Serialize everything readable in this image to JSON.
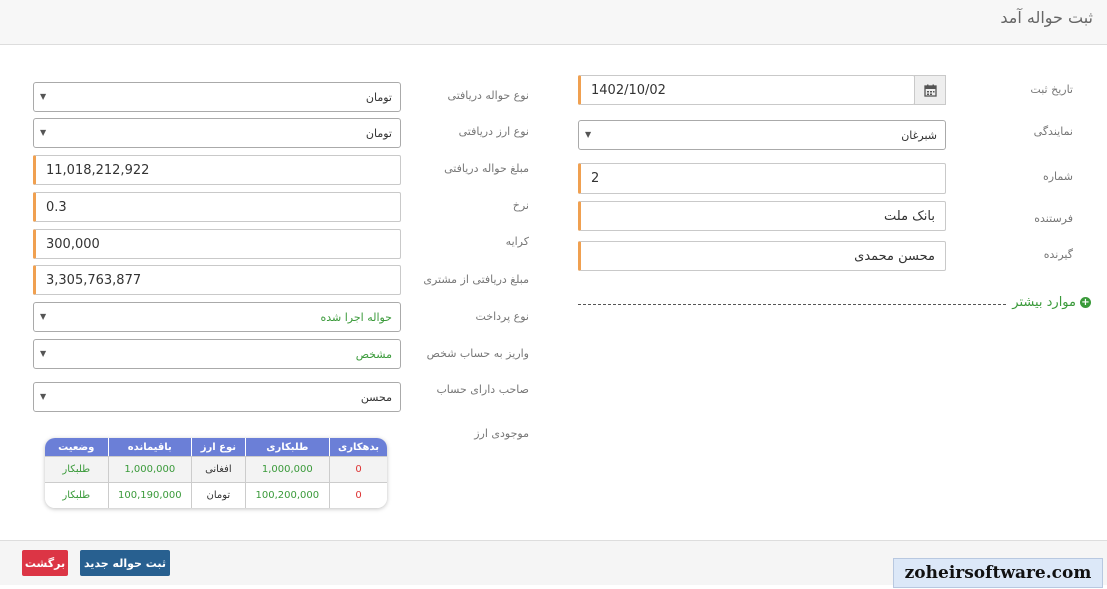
{
  "page": {
    "title": "ثبت حواله آمد"
  },
  "right_form": {
    "date_label": "تاریخ ثبت",
    "date_value": "1402/10/02",
    "agency_label": "نمایندگی",
    "agency_value": "شبرغان",
    "number_label": "شماره",
    "number_value": "2",
    "sender_label": "فرستنده",
    "sender_value": "بانک ملت",
    "receiver_label": "گیرنده",
    "receiver_value": "محسن محمدی",
    "more_label": "موارد بیشتر"
  },
  "left_form": {
    "transfer_type_label": "نوع حواله دریافتی",
    "transfer_type_value": "تومان",
    "currency_type_label": "نوع ارز دریافتی",
    "currency_type_value": "تومان",
    "amount_label": "مبلغ حواله دریافتی",
    "amount_value": "11,018,212,922",
    "rate_label": "نرخ",
    "rate_value": "0.3",
    "fee_label": "کرایه",
    "fee_value": "300,000",
    "customer_amount_label": "مبلغ دریافتی از مشتری",
    "customer_amount_value": "3,305,763,877",
    "payment_type_label": "نوع پرداخت",
    "payment_type_value": "حواله اجرا شده",
    "deposit_label": "واریز به حساب شخص",
    "deposit_value": "مشخص",
    "account_holder_label": "صاحب دارای حساب",
    "account_holder_value": "محسن",
    "balance_label": "موجودی ارز"
  },
  "balance_table": {
    "headers": [
      "بدهکاری",
      "طلبکاری",
      "نوع ارز",
      "باقیمانده",
      "وضعیت"
    ],
    "rows": [
      [
        "0",
        "1,000,000",
        "افغانی",
        "1,000,000",
        "طلبکار"
      ],
      [
        "0",
        "100,200,000",
        "تومان",
        "100,190,000",
        "طلبکار"
      ]
    ]
  },
  "footer": {
    "save_label": "ثبت حواله جدید",
    "back_label": "برگشت"
  },
  "watermark": "zoheirsoftware.com",
  "icons": {
    "calendar": "calendar-icon",
    "plus": "plus-circle-icon",
    "caret": "caret-down-icon"
  },
  "colors": {
    "required_accent": "#f0a050",
    "table_header": "#6b7fd7",
    "save": "#286090",
    "back": "#dc3545",
    "positive": "#3a9a3a"
  }
}
